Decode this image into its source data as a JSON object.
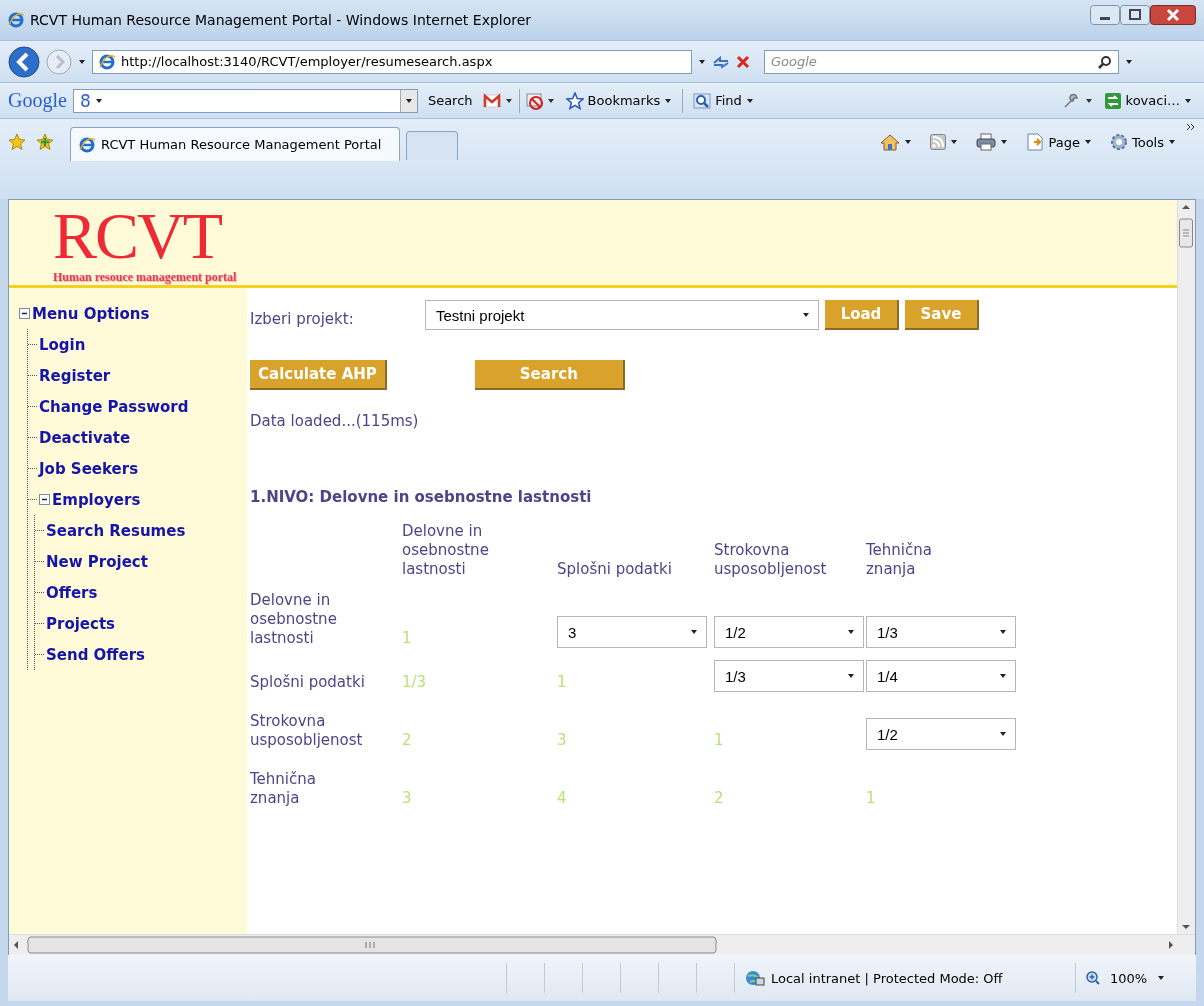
{
  "window": {
    "title": "RCVT Human Resource Management Portal - Windows Internet Explorer"
  },
  "address_bar": {
    "url": "http://localhost:3140/RCVT/employer/resumesearch.aspx"
  },
  "search_box": {
    "placeholder": "Google"
  },
  "google_toolbar": {
    "logo": "Google",
    "g_button": "8",
    "search_button": "Search",
    "bookmarks": "Bookmarks",
    "find": "Find",
    "account": "kovaci…"
  },
  "tabs": [
    {
      "label": "RCVT Human Resource Management Portal",
      "selected": true
    }
  ],
  "command_bar": {
    "page": "Page",
    "tools": "Tools"
  },
  "header": {
    "logo": "RCVT",
    "tagline": "Human resouce management portal"
  },
  "sidebar": {
    "items": [
      {
        "label": "Menu Options",
        "expanded": true,
        "children": [
          {
            "label": "Login"
          },
          {
            "label": "Register"
          },
          {
            "label": "Change Password"
          },
          {
            "label": "Deactivate"
          },
          {
            "label": "Job Seekers"
          },
          {
            "label": "Employers",
            "expanded": true,
            "children": [
              {
                "label": "Search Resumes"
              },
              {
                "label": "New Project"
              },
              {
                "label": "Offers"
              },
              {
                "label": "Projects"
              },
              {
                "label": "Send Offers"
              }
            ]
          }
        ]
      }
    ]
  },
  "project": {
    "label": "Izberi projekt:",
    "value": "Testni projekt",
    "buttons": [
      "Load",
      "Save"
    ]
  },
  "actions": [
    "Calculate AHP",
    "Search"
  ],
  "status_message": "Data loaded...(115ms)",
  "level": {
    "title": "1.NIVO: Delovne in osebnostne lastnosti",
    "columns": [
      "Delovne in osebnostne lastnosti",
      "Splošni podatki",
      "Strokovna usposobljenost",
      "Tehnična znanja"
    ],
    "rows": [
      {
        "label": "Delovne in osebnostne lastnosti",
        "cells": [
          {
            "kind": "value",
            "text": "1"
          },
          {
            "kind": "select",
            "value": "3"
          },
          {
            "kind": "select",
            "value": "1/2"
          },
          {
            "kind": "select",
            "value": "1/3"
          }
        ]
      },
      {
        "label": "Splošni podatki",
        "cells": [
          {
            "kind": "value",
            "text": "1/3"
          },
          {
            "kind": "value",
            "text": "1"
          },
          {
            "kind": "select",
            "value": "1/3"
          },
          {
            "kind": "select",
            "value": "1/4"
          }
        ]
      },
      {
        "label": "Strokovna usposobljenost",
        "cells": [
          {
            "kind": "value",
            "text": "2"
          },
          {
            "kind": "value",
            "text": "3"
          },
          {
            "kind": "value",
            "text": "1"
          },
          {
            "kind": "select",
            "value": "1/2"
          }
        ]
      },
      {
        "label": "Tehnična znanja",
        "cells": [
          {
            "kind": "value",
            "text": "3"
          },
          {
            "kind": "value",
            "text": "4"
          },
          {
            "kind": "value",
            "text": "2"
          },
          {
            "kind": "value",
            "text": "1"
          }
        ]
      }
    ]
  },
  "status_bar": {
    "zone": "Local intranet | Protected Mode: Off",
    "zoom": "100%"
  }
}
